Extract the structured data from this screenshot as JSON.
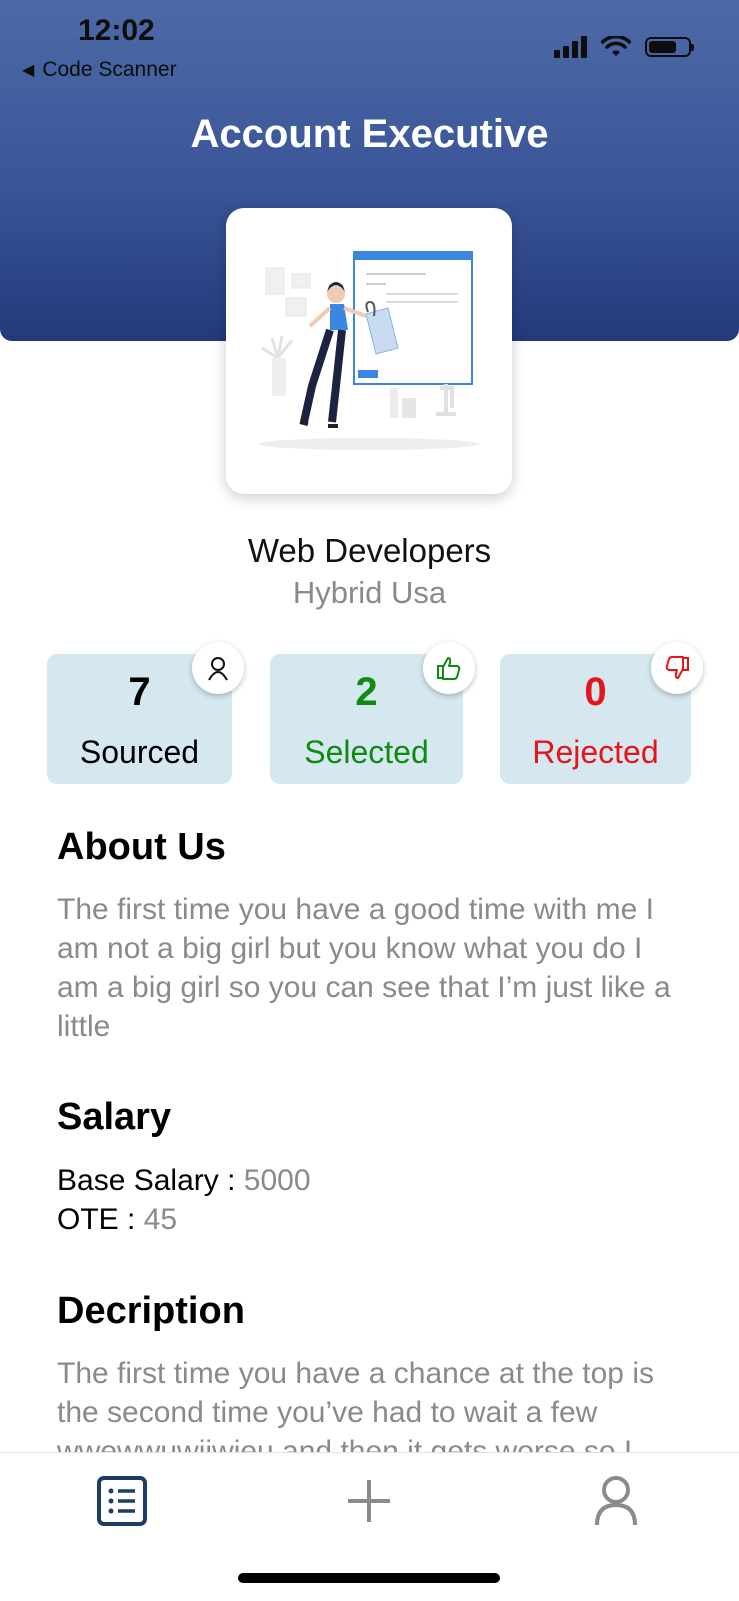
{
  "status_bar": {
    "time": "12:02",
    "back_label": "Code Scanner"
  },
  "header": {
    "title": "Account Executive"
  },
  "company": {
    "name": "Web Developers",
    "location": "Hybrid Usa"
  },
  "stats": [
    {
      "value": "7",
      "label": "Sourced",
      "color": "#000000",
      "icon": "person-icon"
    },
    {
      "value": "2",
      "label": "Selected",
      "color": "#108a10",
      "icon": "thumbs-up-icon"
    },
    {
      "value": "0",
      "label": "Rejected",
      "color": "#e8141b",
      "icon": "thumbs-down-icon"
    }
  ],
  "about": {
    "title": "About Us",
    "text": "The first time you have a good time with me I am not a big girl but you know what you do I am a big girl so you can see that I’m just like a little"
  },
  "salary": {
    "title": "Salary",
    "base_label": "Base Salary : ",
    "base_value": "5000",
    "ote_label": "OTE : ",
    "ote_value": "45"
  },
  "description": {
    "title": "Decription",
    "text": "The first time you have a chance at the top is the second time you’ve had to wait a few wwewwuwiiwieu and then it gets worse so I"
  },
  "tabbar": {
    "items": [
      "list-icon",
      "plus-icon",
      "profile-icon"
    ],
    "active_color": "#1c3d66",
    "inactive_color": "#8a8a8a"
  }
}
